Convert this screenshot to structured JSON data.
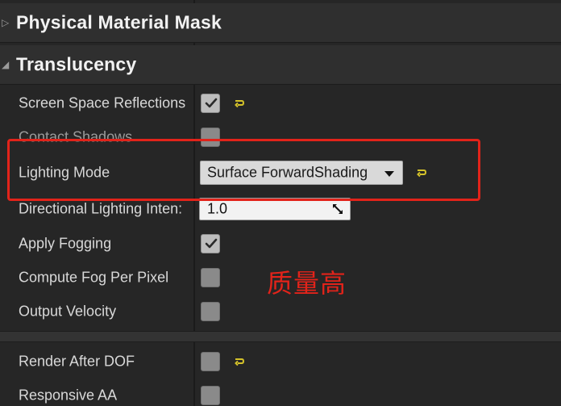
{
  "sections": {
    "physical_material_mask": {
      "title": "Physical Material Mask",
      "expanded": false
    },
    "translucency": {
      "title": "Translucency",
      "expanded": true
    }
  },
  "properties": {
    "screen_space_reflections": {
      "label": "Screen Space Reflections",
      "checked": true,
      "has_reset": true
    },
    "contact_shadows": {
      "label": "Contact Shadows",
      "checked": false,
      "has_reset": false
    },
    "lighting_mode": {
      "label": "Lighting Mode",
      "value": "Surface ForwardShading",
      "has_reset": true
    },
    "directional_lighting_intensity": {
      "label": "Directional Lighting Inten:",
      "value": "1.0"
    },
    "apply_fogging": {
      "label": "Apply Fogging",
      "checked": true
    },
    "compute_fog_per_pixel": {
      "label": "Compute Fog Per Pixel",
      "checked": false
    },
    "output_velocity": {
      "label": "Output Velocity",
      "checked": false
    },
    "render_after_dof": {
      "label": "Render After DOF",
      "checked": false,
      "has_reset": true
    },
    "responsive_aa": {
      "label": "Responsive AA",
      "checked": false
    }
  },
  "annotation": {
    "text": "质量高",
    "color": "#e2231a"
  },
  "colors": {
    "panel_bg": "#262626",
    "reset_icon": "#d4c22a",
    "highlight": "#e2231a"
  },
  "icons": {
    "collapsed_arrow": "▷",
    "expanded_arrow": "◢",
    "checkmark": "check-icon",
    "reset": "reset-arrow-icon",
    "dropdown": "chevron-down-icon",
    "resize": "resize-arrows-icon"
  }
}
